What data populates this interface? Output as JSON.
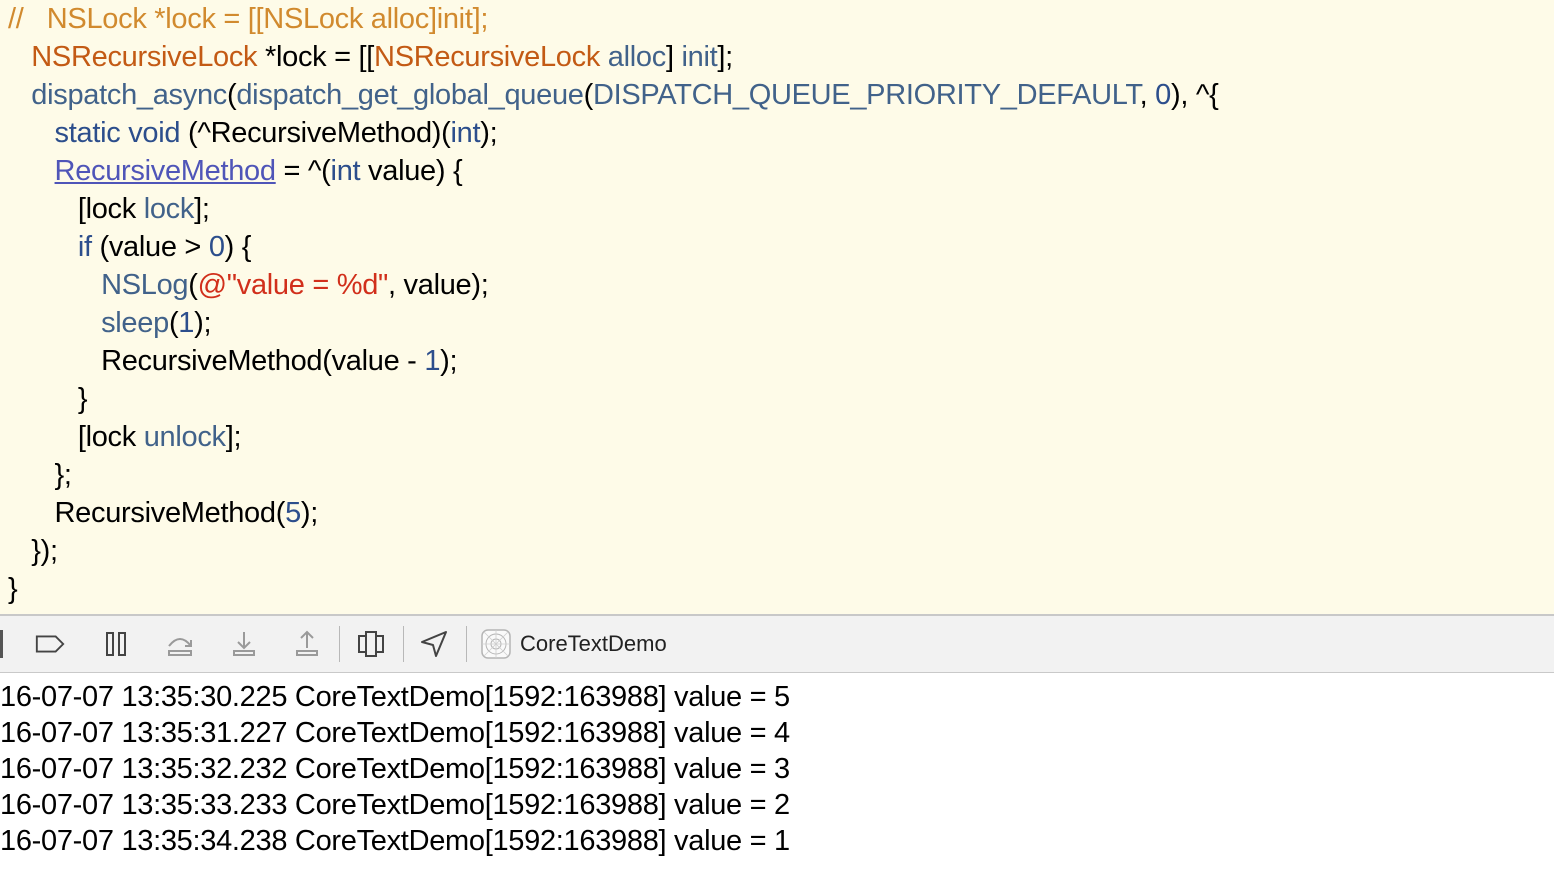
{
  "code": {
    "lines": [
      [
        {
          "t": "//   NSLock *lock = [[NSLock alloc]init];",
          "c": "cm"
        }
      ],
      [
        {
          "t": "   "
        },
        {
          "t": "NSRecursiveLock",
          "c": "ty"
        },
        {
          "t": " *lock = [["
        },
        {
          "t": "NSRecursiveLock",
          "c": "ty"
        },
        {
          "t": " "
        },
        {
          "t": "alloc",
          "c": "fn"
        },
        {
          "t": "] "
        },
        {
          "t": "init",
          "c": "fn"
        },
        {
          "t": "];"
        }
      ],
      [
        {
          "t": "   "
        },
        {
          "t": "dispatch_async",
          "c": "fn"
        },
        {
          "t": "("
        },
        {
          "t": "dispatch_get_global_queue",
          "c": "fn"
        },
        {
          "t": "("
        },
        {
          "t": "DISPATCH_QUEUE_PRIORITY_DEFAULT",
          "c": "fn"
        },
        {
          "t": ", "
        },
        {
          "t": "0",
          "c": "nm"
        },
        {
          "t": "), ^{"
        }
      ],
      [
        {
          "t": "      "
        },
        {
          "t": "static void",
          "c": "kw"
        },
        {
          "t": " (^RecursiveMethod)("
        },
        {
          "t": "int",
          "c": "kw"
        },
        {
          "t": ");"
        }
      ],
      [
        {
          "t": "      "
        },
        {
          "t": "RecursiveMethod",
          "c": "lk"
        },
        {
          "t": " = ^("
        },
        {
          "t": "int",
          "c": "kw"
        },
        {
          "t": " value) {"
        }
      ],
      [
        {
          "t": "         [lock "
        },
        {
          "t": "lock",
          "c": "fn"
        },
        {
          "t": "];"
        }
      ],
      [
        {
          "t": "         "
        },
        {
          "t": "if",
          "c": "kw"
        },
        {
          "t": " (value > "
        },
        {
          "t": "0",
          "c": "nm"
        },
        {
          "t": ") {"
        }
      ],
      [
        {
          "t": "            "
        },
        {
          "t": "NSLog",
          "c": "fn"
        },
        {
          "t": "("
        },
        {
          "t": "@\"value = %d\"",
          "c": "st"
        },
        {
          "t": ", value);"
        }
      ],
      [
        {
          "t": "            "
        },
        {
          "t": "sleep",
          "c": "fn"
        },
        {
          "t": "("
        },
        {
          "t": "1",
          "c": "nm"
        },
        {
          "t": ");"
        }
      ],
      [
        {
          "t": "            RecursiveMethod(value - "
        },
        {
          "t": "1",
          "c": "nm"
        },
        {
          "t": ");"
        }
      ],
      [
        {
          "t": "         }"
        }
      ],
      [
        {
          "t": "         [lock "
        },
        {
          "t": "unlock",
          "c": "fn"
        },
        {
          "t": "];"
        }
      ],
      [
        {
          "t": "      };"
        }
      ],
      [
        {
          "t": "      RecursiveMethod("
        },
        {
          "t": "5",
          "c": "nm"
        },
        {
          "t": ");"
        }
      ],
      [
        {
          "t": "   });"
        }
      ],
      [
        {
          "t": "}"
        }
      ]
    ]
  },
  "debugbar": {
    "buttons": [
      {
        "name": "breakpoints-toggle-button",
        "icon": "breakpoint-icon"
      },
      {
        "name": "pause-button",
        "icon": "pause-icon"
      },
      {
        "name": "step-over-button",
        "icon": "step-over-icon"
      },
      {
        "name": "step-into-button",
        "icon": "step-into-icon"
      },
      {
        "name": "step-out-button",
        "icon": "step-out-icon"
      },
      {
        "name": "view-hierarchy-button",
        "icon": "view-hierarchy-icon"
      },
      {
        "name": "simulate-location-button",
        "icon": "location-arrow-icon"
      }
    ],
    "scheme_icon": "app-target-icon",
    "scheme_label": "CoreTextDemo"
  },
  "console": {
    "lines": [
      "16-07-07 13:35:30.225 CoreTextDemo[1592:163988] value = 5",
      "16-07-07 13:35:31.227 CoreTextDemo[1592:163988] value = 4",
      "16-07-07 13:35:32.232 CoreTextDemo[1592:163988] value = 3",
      "16-07-07 13:35:33.233 CoreTextDemo[1592:163988] value = 2",
      "16-07-07 13:35:34.238 CoreTextDemo[1592:163988] value = 1"
    ]
  }
}
